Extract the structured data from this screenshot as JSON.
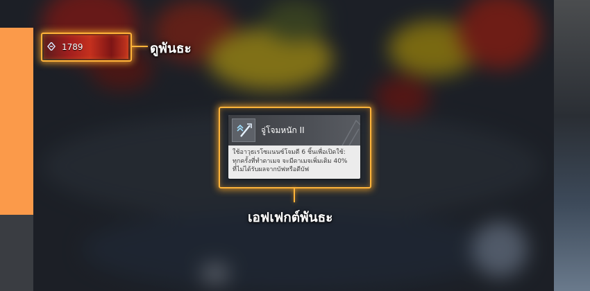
{
  "hud": {
    "stat_value": "1789"
  },
  "callouts": {
    "view_relic": "ดูพันธะ",
    "relic_effect": "เอฟเฟกต์พันธะ"
  },
  "effect_card": {
    "title": "จู่โจมหนัก II",
    "description_lines": [
      "ใช้อาวุธเรโซแนนซ์โจมตี 6 ชิ้นเพื่อเปิดใช้:",
      "ทุกครั้งที่ทำดาเมจ จะมีดาเมจเพิ่มเติม 40%",
      "ที่ไม่ได้รับผลจากบัฟหรือดีบัฟ"
    ],
    "icon": "arrow-up-sword-icon"
  },
  "colors": {
    "highlight": "#ffb43a",
    "side_panel": "#fb9a4a"
  }
}
